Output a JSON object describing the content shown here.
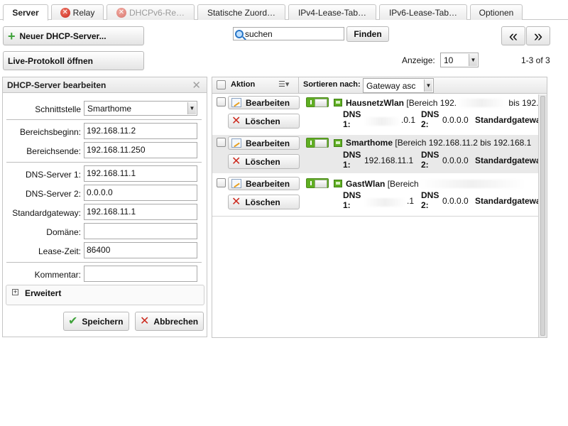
{
  "tabs": [
    {
      "label": "Server",
      "icon": null,
      "active": true,
      "disabled": false
    },
    {
      "label": "Relay",
      "icon": "error-icon",
      "active": false,
      "disabled": false
    },
    {
      "label": "DHCPv6-Re…",
      "icon": "error-icon",
      "active": false,
      "disabled": true
    },
    {
      "label": "Statische Zuord…",
      "icon": null,
      "active": false,
      "disabled": false
    },
    {
      "label": "IPv4-Lease-Tab…",
      "icon": null,
      "active": false,
      "disabled": false
    },
    {
      "label": "IPv6-Lease-Tab…",
      "icon": null,
      "active": false,
      "disabled": false
    },
    {
      "label": "Optionen",
      "icon": null,
      "active": false,
      "disabled": false
    }
  ],
  "toolbar": {
    "new_server_label": "Neuer DHCP-Server...",
    "live_log_label": "Live-Protokoll öffnen",
    "search_placeholder": "suchen",
    "search_button": "Finden",
    "prev_label": "«",
    "next_label": "»",
    "display_label": "Anzeige:",
    "display_value": "10",
    "range_label": "1-3 of 3"
  },
  "editor": {
    "title": "DHCP-Server bearbeiten",
    "fields": {
      "interface": {
        "label": "Schnittstelle",
        "value": "Smarthome"
      },
      "range_start": {
        "label": "Bereichsbeginn:",
        "value": "192.168.11.2"
      },
      "range_end": {
        "label": "Bereichsende:",
        "value": "192.168.11.250"
      },
      "dns1": {
        "label": "DNS-Server 1:",
        "value": "192.168.11.1"
      },
      "dns2": {
        "label": "DNS-Server 2:",
        "value": "0.0.0.0"
      },
      "gateway": {
        "label": "Standardgateway:",
        "value": "192.168.11.1"
      },
      "domain": {
        "label": "Domäne:",
        "value": ""
      },
      "lease": {
        "label": "Lease-Zeit:",
        "value": "86400"
      },
      "comment": {
        "label": "Kommentar:",
        "value": ""
      }
    },
    "advanced_label": "Erweitert",
    "advanced_toggle": "+",
    "save_label": "Speichern",
    "cancel_label": "Abbrechen"
  },
  "list": {
    "action_header": "Aktion",
    "sort_label": "Sortieren nach:",
    "sort_value": "Gateway asc",
    "edit_label": "Bearbeiten",
    "delete_label": "Löschen",
    "dns1_label_a": "DNS",
    "dns1_label_b": "1:",
    "dns2_label_a": "DNS",
    "dns2_label_b": "2:",
    "gateway_label": "Standardgateway",
    "rows": [
      {
        "name": "HausnetzWlan",
        "range": "[Bereich 192.",
        "range_tail": "bis 192.1",
        "dns1": ".0.1",
        "dns2": "0.0.0.0",
        "gateway": "Standardgatewa"
      },
      {
        "name": "Smarthome",
        "range": "[Bereich 192.168.11.2 bis 192.168.1",
        "range_tail": "",
        "dns1": "192.168.11.1",
        "dns2": "0.0.0.0",
        "gateway": "Standardgatewa"
      },
      {
        "name": "GastWlan",
        "range": "[Bereich",
        "range_tail": "",
        "dns1": ".1",
        "dns2": "0.0.0.0",
        "gateway": "Standardgatewa"
      }
    ]
  },
  "colors": {
    "accent_green": "#5fae22",
    "error_red": "#c9261a"
  }
}
